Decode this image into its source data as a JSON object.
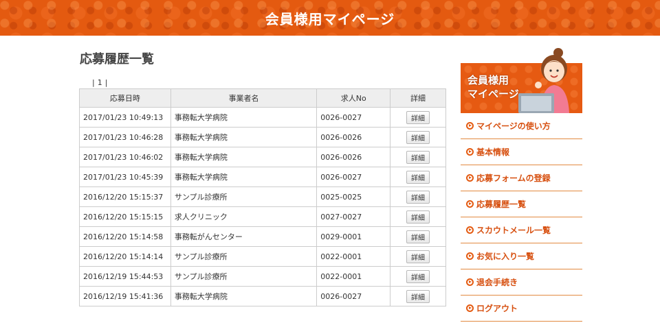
{
  "header": {
    "title": "会員様用マイページ"
  },
  "page": {
    "title": "応募履歴一覧"
  },
  "pagination": {
    "left": "|",
    "current": "1",
    "right": "|"
  },
  "table": {
    "headers": [
      "応募日時",
      "事業者名",
      "求人No",
      "詳細"
    ],
    "detail_label": "詳細",
    "rows": [
      {
        "date": "2017/01/23 10:49:13",
        "company": "事務転大学病院",
        "job_no": "0026-0027"
      },
      {
        "date": "2017/01/23 10:46:28",
        "company": "事務転大学病院",
        "job_no": "0026-0026"
      },
      {
        "date": "2017/01/23 10:46:02",
        "company": "事務転大学病院",
        "job_no": "0026-0026"
      },
      {
        "date": "2017/01/23 10:45:39",
        "company": "事務転大学病院",
        "job_no": "0026-0027"
      },
      {
        "date": "2016/12/20 15:15:37",
        "company": "サンプル診療所",
        "job_no": "0025-0025"
      },
      {
        "date": "2016/12/20 15:15:15",
        "company": "求人クリニック",
        "job_no": "0027-0027"
      },
      {
        "date": "2016/12/20 15:14:58",
        "company": "事務転がんセンター",
        "job_no": "0029-0001"
      },
      {
        "date": "2016/12/20 15:14:14",
        "company": "サンプル診療所",
        "job_no": "0022-0001"
      },
      {
        "date": "2016/12/19 15:44:53",
        "company": "サンプル診療所",
        "job_no": "0022-0001"
      },
      {
        "date": "2016/12/19 15:41:36",
        "company": "事務転大学病院",
        "job_no": "0026-0027"
      }
    ]
  },
  "sidebar": {
    "banner": {
      "line1": "会員様用",
      "line2": "マイページ"
    },
    "menu": [
      {
        "label": "マイページの使い方",
        "id": "howto"
      },
      {
        "label": "基本情報",
        "id": "profile"
      },
      {
        "label": "応募フォームの登録",
        "id": "form"
      },
      {
        "label": "応募履歴一覧",
        "id": "history"
      },
      {
        "label": "スカウトメール一覧",
        "id": "scout"
      },
      {
        "label": "お気に入り一覧",
        "id": "favorites"
      },
      {
        "label": "退会手続き",
        "id": "withdraw"
      },
      {
        "label": "ログアウト",
        "id": "logout"
      }
    ]
  },
  "colors": {
    "accent": "#e45a10",
    "menu_text": "#d75010",
    "divider": "#e2893f"
  }
}
